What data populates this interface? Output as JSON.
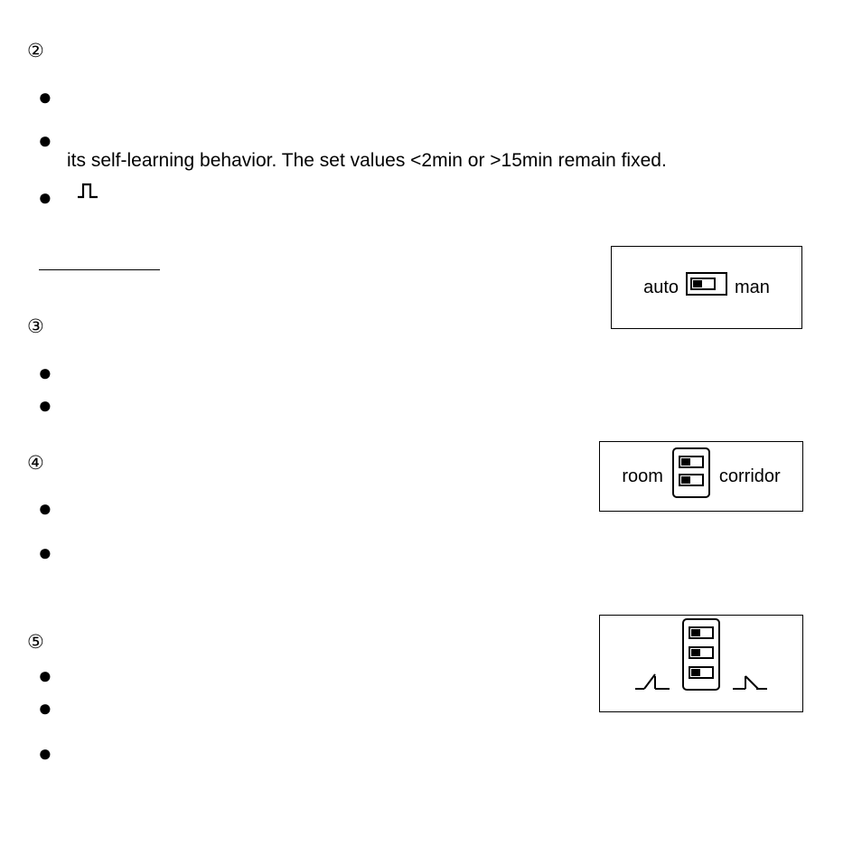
{
  "section2": {
    "marker": "②",
    "text_line": "its self-learning behavior. The set values <2min or >15min remain fixed."
  },
  "section3": {
    "marker": "③"
  },
  "section4": {
    "marker": "④"
  },
  "section5": {
    "marker": "⑤"
  },
  "switches": {
    "auto_man": {
      "left": "auto",
      "right": "man"
    },
    "room_corridor": {
      "left": "room",
      "right": "corridor"
    }
  }
}
